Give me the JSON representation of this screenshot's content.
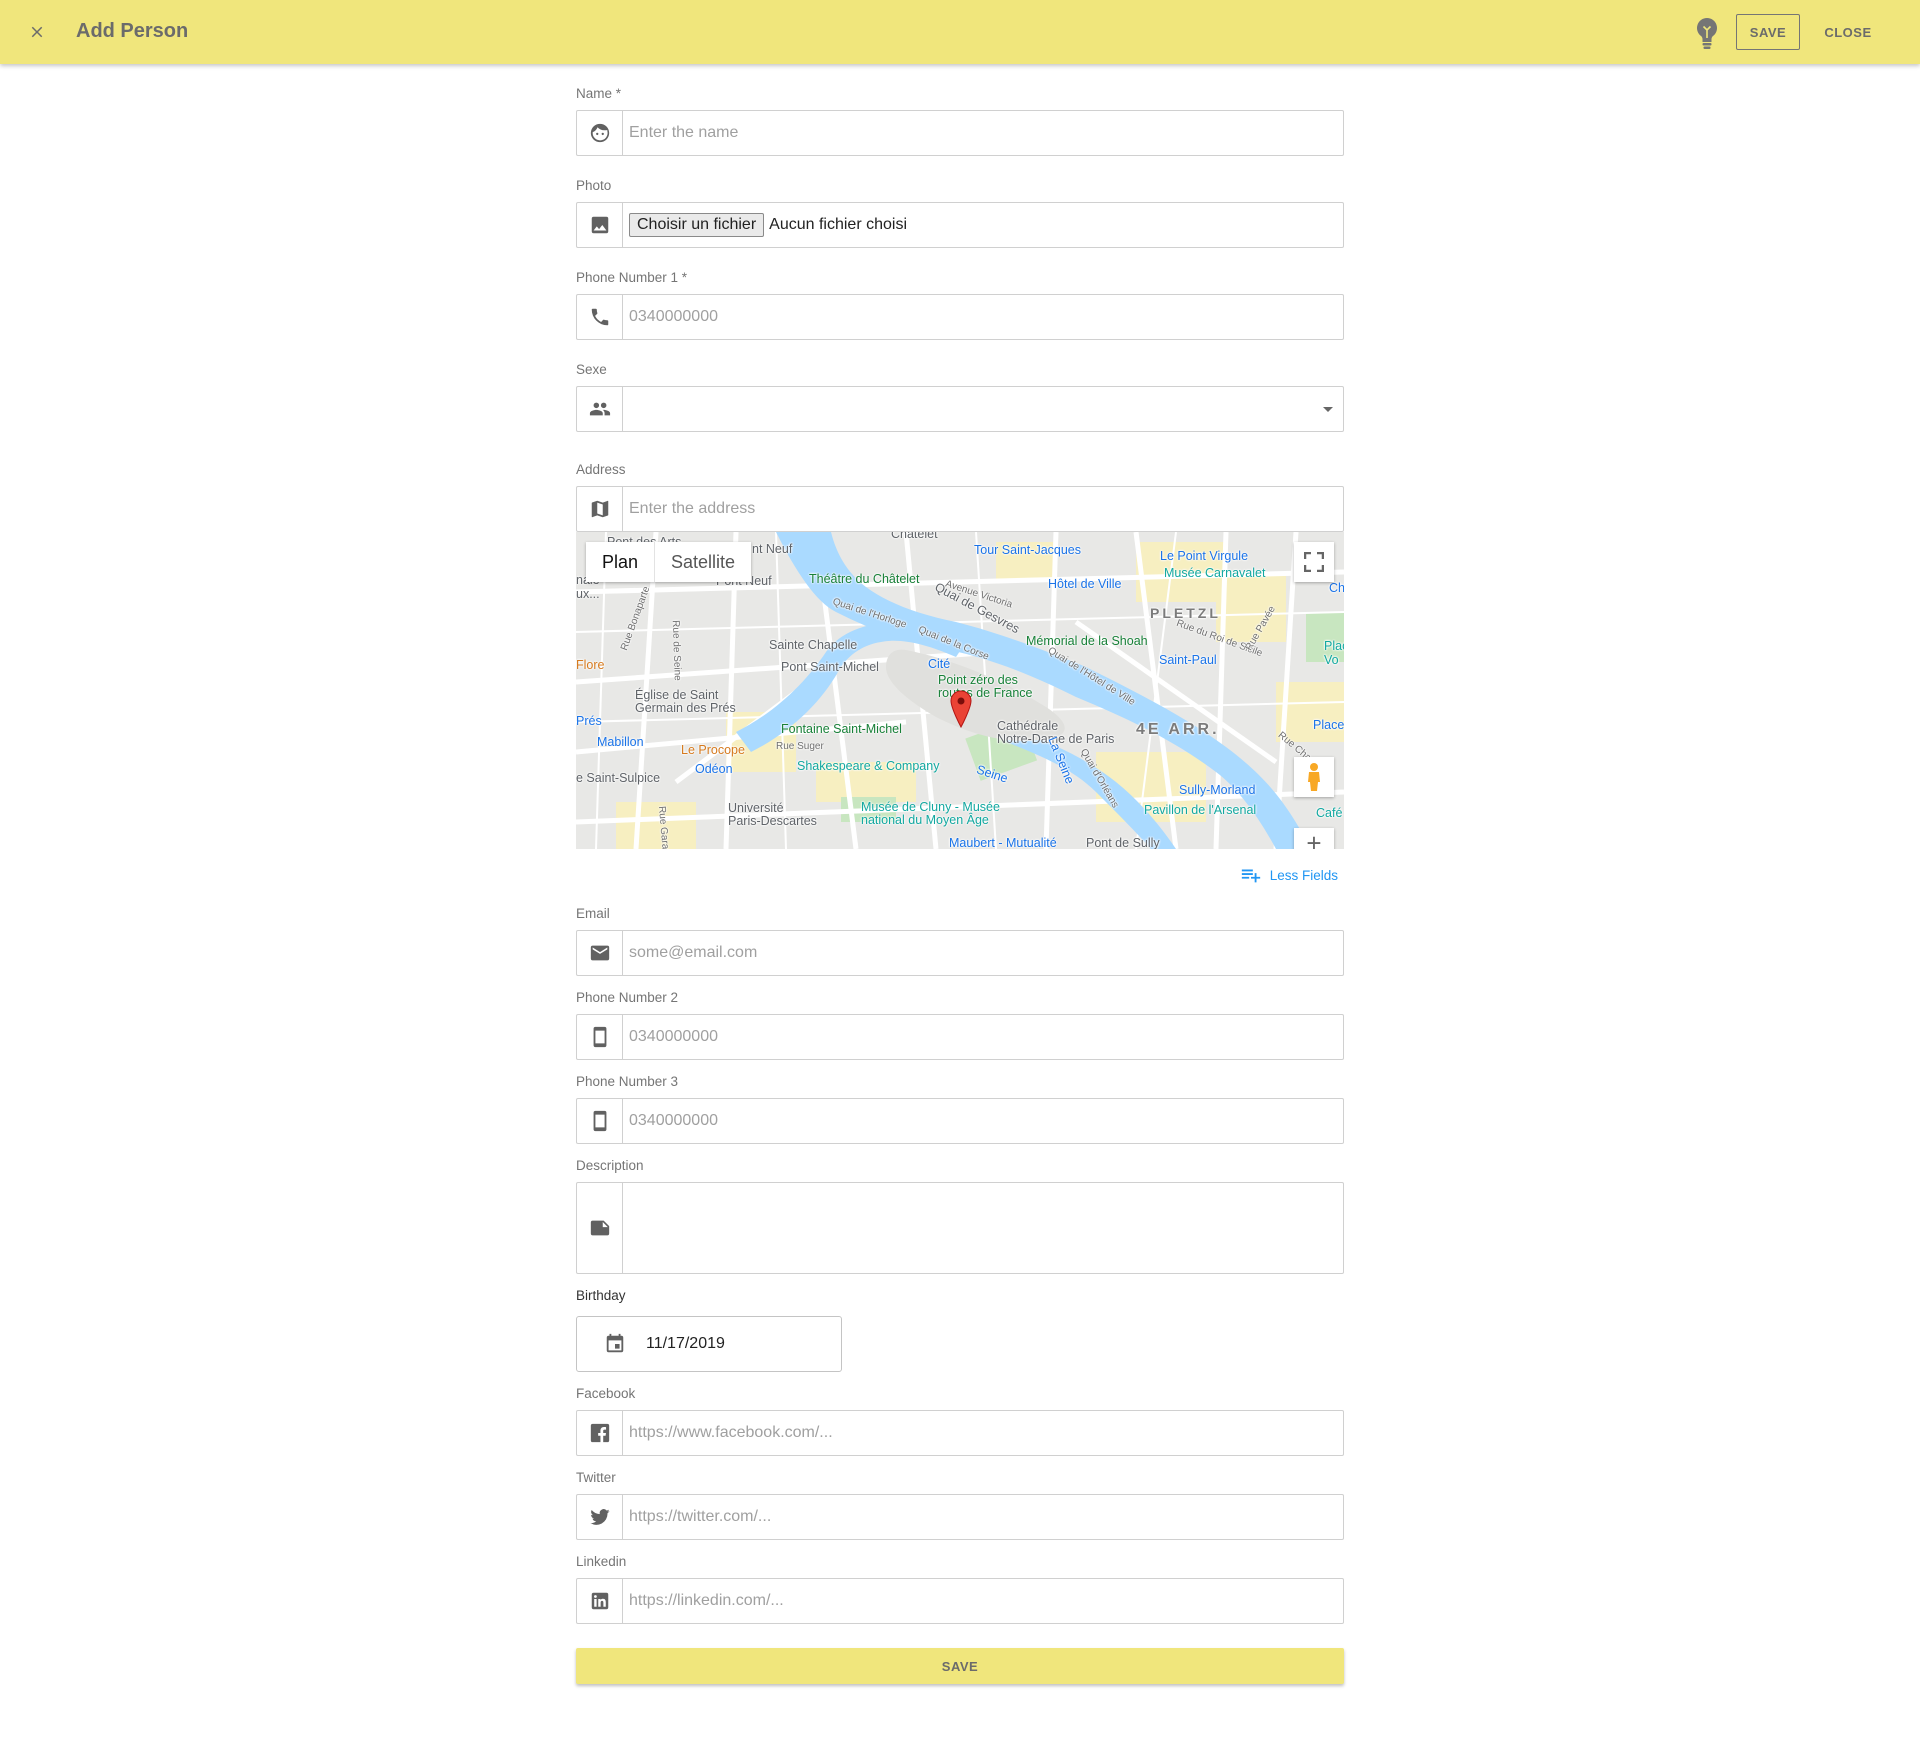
{
  "header": {
    "title": "Add Person",
    "save_label": "SAVE",
    "close_label": "CLOSE",
    "bg_color": "#f0e67c"
  },
  "form": {
    "name": {
      "label": "Name  *",
      "placeholder": "Enter the name",
      "icon": "face-icon"
    },
    "photo": {
      "label": "Photo",
      "button_label": "Choisir un fichier",
      "status": "Aucun fichier choisi",
      "icon": "image-icon"
    },
    "phone1": {
      "label": "Phone Number 1  *",
      "placeholder": "0340000000",
      "icon": "phone-icon"
    },
    "sexe": {
      "label": "Sexe",
      "value": "",
      "icon": "people-icon"
    },
    "address": {
      "label": "Address",
      "placeholder": "Enter the address",
      "icon": "map-icon"
    },
    "map": {
      "tab_plan": "Plan",
      "tab_satellite": "Satellite",
      "active_tab": "Plan",
      "labels": {
        "chatelet": "Châtelet",
        "pont_des_arts": "Pont des Arts",
        "pont_neuf_m": "nt Neuf",
        "tour_st_jacques": "Tour Saint-Jacques",
        "le_point_virgule": "Le Point Virgule",
        "musee_carnavalet": "Musée Carnavalet",
        "hotel_de_ville": "Hôtel de Ville",
        "theatre_chatelet": "Théâtre du Châtelet",
        "pont_neuf": "Pont Neuf",
        "quai_gesvres": "Quai de Gesvres",
        "pletzl": "PLETZL",
        "nale": "nale",
        "ux": "ux...",
        "rue_bonaparte": "Rue Bonaparte",
        "rue_de_seine": "Rue de Seine",
        "sainte_chapelle": "Sainte Chapelle",
        "memorial_shoah": "Mémorial de la Shoah",
        "saint_paul": "Saint-Paul",
        "flore": "Flore",
        "pont_st_michel": "Pont Saint-Michel",
        "cite": "Cité",
        "point_zero": "Point zéro des\nroutes de France",
        "eglise_st_germain": "Église de Saint\nGermain des Prés",
        "pres": "Prés",
        "fontaine_st_michel": "Fontaine Saint-Michel",
        "cathedrale": "Cathédrale\nNotre-Dame de Paris",
        "quatre_arr": "4E ARR.",
        "mabillon": "Mabillon",
        "le_procope": "Le Procope",
        "odeon": "Odéon",
        "shakespeare": "Shakespeare & Company",
        "seine": "Seine",
        "la_seine": "La Seine",
        "st_sulpice": "e Saint-Sulpice",
        "sully_morland": "Sully-Morland",
        "universite": "Université\nParis-Descartes",
        "cluny": "Musée de Cluny - Musée\nnational du Moyen Âge",
        "pavillon_arsenal": "Pavillon de l'Arsenal",
        "maubert": "Maubert - Mutualité",
        "pont_sully": "Pont de Sully",
        "place": "Place",
        "plac": "Plac",
        "vo": "Vo",
        "ch": "Ch",
        "cafe": "Café",
        "quai_horloge": "Quai de l'Horloge",
        "quai_corse": "Quai de la Corse",
        "avenue_victoria": "Avenue Victoria",
        "quai_hotel_ville": "Quai de l'Hôtel de Ville",
        "rue_roi_sicile": "Rue du Roi de Sicile",
        "rue_pavee": "Rue Pavée",
        "rue_suger": "Rue Suger",
        "rue_garan": "Rue Garan",
        "rue_charl": "Rue Charl",
        "quai_orleans": "Quai d'Orléans"
      }
    },
    "less_fields": "Less Fields",
    "email": {
      "label": "Email",
      "placeholder": "some@email.com",
      "icon": "email-icon"
    },
    "phone2": {
      "label": "Phone Number 2",
      "placeholder": "0340000000",
      "icon": "smartphone-icon"
    },
    "phone3": {
      "label": "Phone Number 3",
      "placeholder": "0340000000",
      "icon": "smartphone-icon"
    },
    "description": {
      "label": "Description",
      "value": "",
      "icon": "note-icon"
    },
    "birthday": {
      "label": "Birthday",
      "value": "11/17/2019",
      "icon": "calendar-icon"
    },
    "facebook": {
      "label": "Facebook",
      "placeholder": "https://www.facebook.com/...",
      "icon": "facebook-icon"
    },
    "twitter": {
      "label": "Twitter",
      "placeholder": "https://twitter.com/...",
      "icon": "twitter-icon"
    },
    "linkedin": {
      "label": "Linkedin",
      "placeholder": "https://linkedin.com/...",
      "icon": "linkedin-icon"
    },
    "save_label": "SAVE"
  }
}
